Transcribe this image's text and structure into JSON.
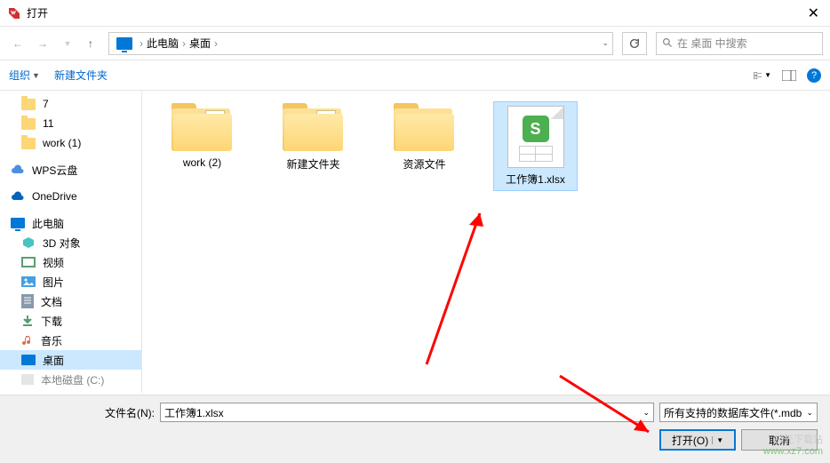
{
  "title": "打开",
  "breadcrumb": {
    "pc": "此电脑",
    "desktop": "桌面"
  },
  "search_placeholder": "在 桌面 中搜索",
  "toolbar": {
    "organize": "组织",
    "newfolder": "新建文件夹"
  },
  "sidebar": {
    "items": [
      {
        "label": "7",
        "type": "folder"
      },
      {
        "label": "11",
        "type": "folder"
      },
      {
        "label": "work (1)",
        "type": "folder"
      },
      {
        "label": "WPS云盘",
        "type": "wps"
      },
      {
        "label": "OneDrive",
        "type": "onedrive"
      },
      {
        "label": "此电脑",
        "type": "pc"
      },
      {
        "label": "3D 对象",
        "type": "3d"
      },
      {
        "label": "视频",
        "type": "video"
      },
      {
        "label": "图片",
        "type": "picture"
      },
      {
        "label": "文档",
        "type": "doc"
      },
      {
        "label": "下载",
        "type": "download"
      },
      {
        "label": "音乐",
        "type": "music"
      },
      {
        "label": "桌面",
        "type": "desktop",
        "selected": true
      },
      {
        "label": "本地磁盘 (C:)",
        "type": "disk"
      }
    ]
  },
  "files": [
    {
      "label": "work (2)",
      "kind": "folder-doc"
    },
    {
      "label": "新建文件夹",
      "kind": "folder-doc"
    },
    {
      "label": "资源文件",
      "kind": "folder-gear"
    },
    {
      "label": "工作簿1.xlsx",
      "kind": "xlsx",
      "selected": true
    }
  ],
  "filename_label": "文件名(N):",
  "filename_value": "工作簿1.xlsx",
  "filetype_value": "所有支持的数据库文件(*.mdb",
  "buttons": {
    "open": "打开(O)",
    "cancel": "取消"
  },
  "watermark": {
    "line1": "极光下载站",
    "line2": "www.xz7.com"
  }
}
